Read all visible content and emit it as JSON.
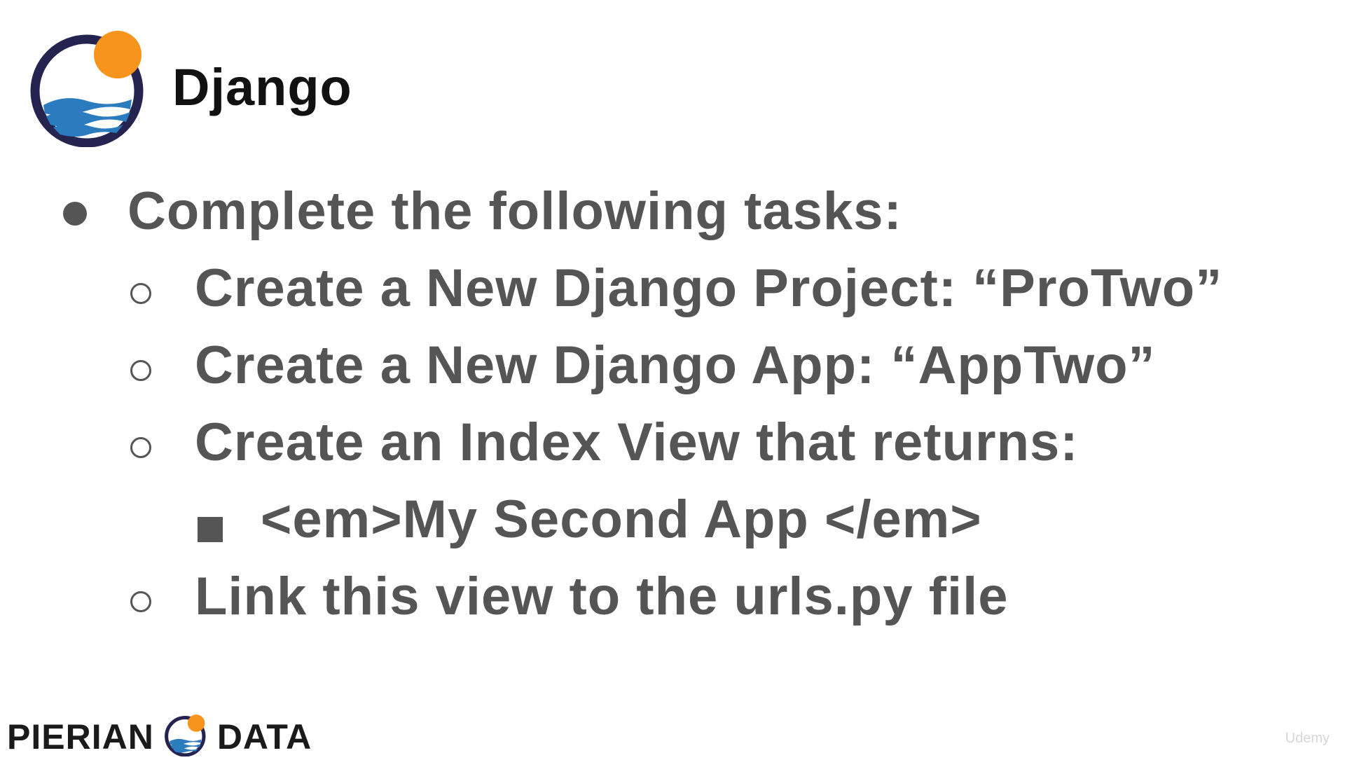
{
  "header": {
    "title": "Django",
    "logo_icon": "pierian-logo-icon"
  },
  "content": {
    "items": [
      {
        "level": 1,
        "bullet": "disc",
        "text": "Complete the following tasks:"
      },
      {
        "level": 2,
        "bullet": "circle",
        "text": "Create a New Django Project: “ProTwo”"
      },
      {
        "level": 2,
        "bullet": "circle",
        "text": "Create a New Django App: “AppTwo”"
      },
      {
        "level": 2,
        "bullet": "circle",
        "text": "Create an Index View that returns:"
      },
      {
        "level": 3,
        "bullet": "square",
        "text": "<em>My Second App </em>"
      },
      {
        "level": 2,
        "bullet": "circle",
        "text": "Link this view to the urls.py file"
      }
    ]
  },
  "footer": {
    "brand_left": "PIERIAN",
    "brand_right": "DATA",
    "watermark": "Udemy"
  },
  "colors": {
    "text_gray": "#555555",
    "title_black": "#111111",
    "logo_navy": "#25234f",
    "logo_orange": "#f7941d",
    "logo_blue": "#2b7bbf"
  }
}
